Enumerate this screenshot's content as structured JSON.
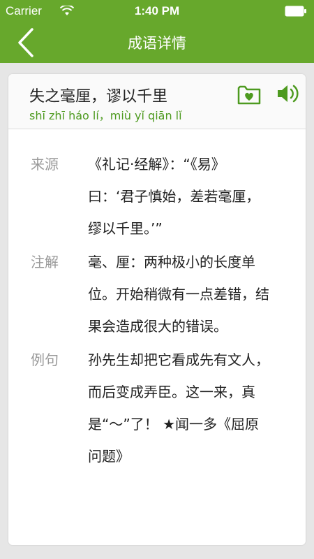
{
  "status_bar": {
    "carrier": "Carrier",
    "time": "1:40 PM"
  },
  "nav": {
    "title": "成语详情"
  },
  "idiom": {
    "title": "失之毫厘，谬以千里",
    "pinyin": "shī zhī háo lí，miù yǐ qiān lǐ"
  },
  "sections": {
    "source": {
      "label": "来源",
      "text": "《礼记·经解》：“《易》\n曰：‘君子慎始，差若毫厘，\n缪以千里。’”"
    },
    "explanation": {
      "label": "注解",
      "text": "毫、厘：两种极小的长度单\n位。开始稍微有一点差错，结\n果会造成很大的错误。"
    },
    "example": {
      "label": "例句",
      "text": "孙先生却把它看成先有文人，\n而后变成弄臣。这一来，真\n是“～”了！ ★闻一多《屈原\n问题》"
    }
  },
  "colors": {
    "accent": "#67a82c",
    "pinyin": "#4d9a1f",
    "label": "#999999"
  },
  "icons": [
    "wifi-icon",
    "battery-icon",
    "back-chevron-icon",
    "favorite-heart-folder-icon",
    "speaker-icon"
  ]
}
